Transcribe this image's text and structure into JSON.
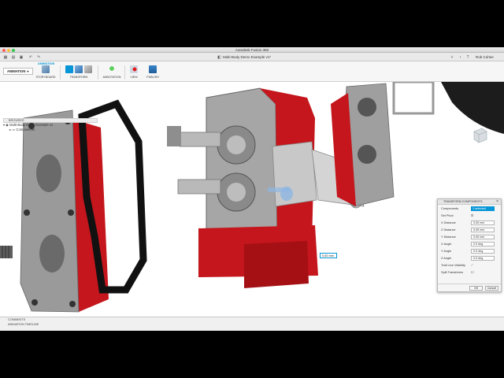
{
  "window": {
    "title": "Autodesk Fusion 360"
  },
  "document": {
    "title": "Multi-Body Demo Example v1*"
  },
  "user": {
    "name": "Rob Cohee"
  },
  "workspace": {
    "label": "ANIMATION"
  },
  "ribbon": {
    "tab": "ANIMATION",
    "groups": [
      {
        "label": "STORYBOARD"
      },
      {
        "label": "TRANSFORM"
      },
      {
        "label": "ANNOTATION"
      },
      {
        "label": "VIEW"
      },
      {
        "label": "PUBLISH"
      }
    ]
  },
  "browser": {
    "header": "BROWSER",
    "root": "Multi-Body Demo Example v1",
    "child": "Components"
  },
  "panel": {
    "title": "TRANSFORM COMPONENTS",
    "rows": [
      {
        "label": "Components",
        "value": "1 selected"
      },
      {
        "label": "Set Pivot",
        "value": ""
      },
      {
        "label": "X Distance",
        "value": "0.00 mm"
      },
      {
        "label": "Z Distance",
        "value": "0.00 mm"
      },
      {
        "label": "Y Distance",
        "value": "0.00 mm"
      },
      {
        "label": "X Angle",
        "value": "0.0 deg"
      },
      {
        "label": "Y Angle",
        "value": "0.0 deg"
      },
      {
        "label": "Z Angle",
        "value": "0.0 deg"
      },
      {
        "label": "Trail Line Visibility",
        "value": ""
      },
      {
        "label": "Split Transforms",
        "value": ""
      }
    ],
    "ok": "OK",
    "cancel": "Cancel"
  },
  "dimension": {
    "value": "0.00 mm"
  },
  "bottom": {
    "comments": "COMMENTS",
    "timeline": "ANIMATION TIMELINE"
  },
  "colors": {
    "accent": "#0696d7",
    "part_red": "#c4161c",
    "metal": "#9a9a9a"
  }
}
